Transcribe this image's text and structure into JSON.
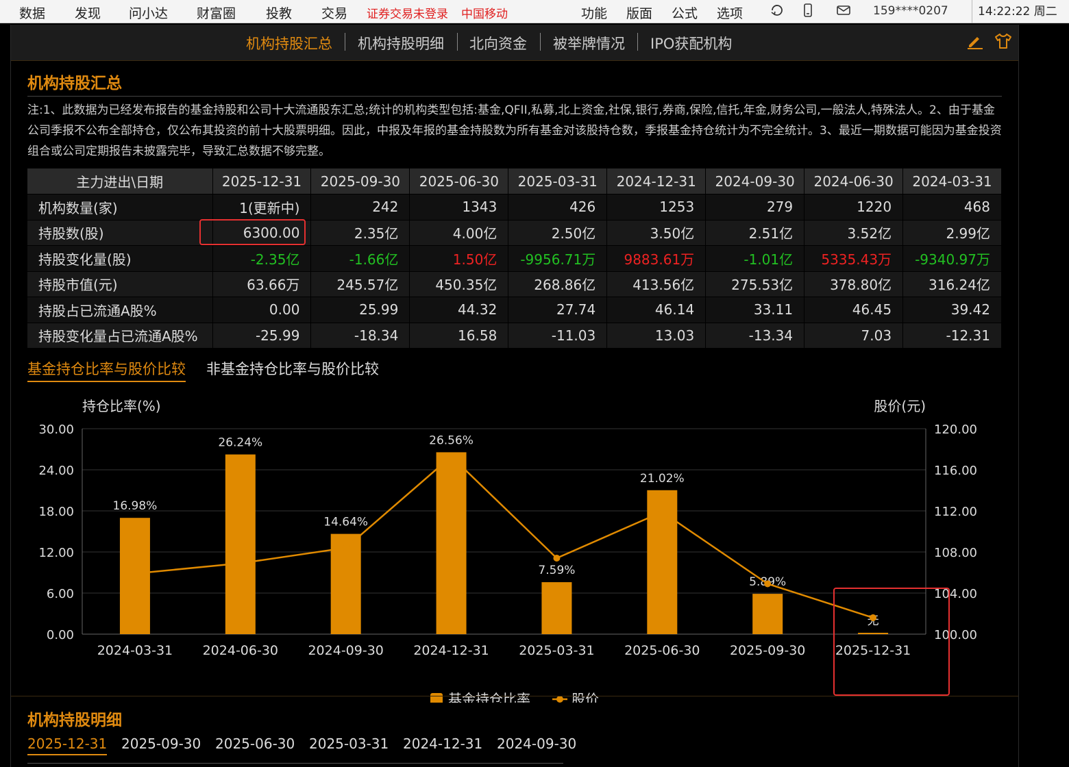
{
  "topbar": {
    "menu": [
      "数据",
      "发现",
      "问小达",
      "财富圈",
      "投教",
      "交易"
    ],
    "warning": "证券交易未登录",
    "carrier": "中国移动",
    "right_menu": [
      "功能",
      "版面",
      "公式",
      "选项"
    ],
    "phone": "159****0207",
    "time": "14:22:22 周二"
  },
  "subnav": {
    "tabs": [
      "机构持股汇总",
      "机构持股明细",
      "北向资金",
      "被举牌情况",
      "IPO获配机构"
    ],
    "active_index": 0
  },
  "summary": {
    "title": "机构持股汇总",
    "note": "注:1、此数据为已经发布报告的基金持股和公司十大流通股东汇总;统计的机构类型包括:基金,QFII,私募,北上资金,社保,银行,券商,保险,信托,年金,财务公司,一般法人,特殊法人。2、由于基金公司季报不公布全部持仓，仅公布其投资的前十大股票明细。因此，中报及年报的基金持股数为所有基金对该股持仓数，季报基金持仓统计为不完全统计。3、最近一期数据可能因为基金投资组合或公司定期报告未披露完毕，导致汇总数据不够完整。"
  },
  "table": {
    "header_label": "主力进出\\日期",
    "dates": [
      "2025-12-31",
      "2025-09-30",
      "2025-06-30",
      "2025-03-31",
      "2024-12-31",
      "2024-09-30",
      "2024-06-30",
      "2024-03-31"
    ],
    "rows": [
      {
        "label": "机构数量(家)",
        "values": [
          "1(更新中)",
          "242",
          "1343",
          "426",
          "1253",
          "279",
          "1220",
          "468"
        ]
      },
      {
        "label": "持股数(股)",
        "values": [
          "6300.00",
          "2.35亿",
          "4.00亿",
          "2.50亿",
          "3.50亿",
          "2.51亿",
          "3.52亿",
          "2.99亿"
        ]
      },
      {
        "label": "持股变化量(股)",
        "values": [
          "-2.35亿",
          "-1.66亿",
          "1.50亿",
          "-9956.71万",
          "9883.61万",
          "-1.01亿",
          "5335.43万",
          "-9340.97万"
        ]
      },
      {
        "label": "持股市值(元)",
        "values": [
          "63.66万",
          "245.57亿",
          "450.35亿",
          "268.86亿",
          "413.56亿",
          "275.53亿",
          "378.80亿",
          "316.24亿"
        ]
      },
      {
        "label": "持股占已流通A股%",
        "values": [
          "0.00",
          "25.99",
          "44.32",
          "27.74",
          "46.14",
          "33.11",
          "46.45",
          "39.42"
        ]
      },
      {
        "label": "持股变化量占已流通A股%",
        "values": [
          "-25.99",
          "-18.34",
          "16.58",
          "-11.03",
          "13.03",
          "-13.34",
          "7.03",
          "-12.31"
        ]
      }
    ]
  },
  "chart_tabs": [
    "基金持仓比率与股价比较",
    "非基金持仓比率与股价比较"
  ],
  "chart_data": {
    "type": "bar",
    "categories": [
      "2024-03-31",
      "2024-06-30",
      "2024-09-30",
      "2024-12-31",
      "2025-03-31",
      "2025-06-30",
      "2025-09-30",
      "2025-12-31"
    ],
    "series": [
      {
        "name": "基金持仓比率",
        "type": "bar",
        "axis": "left",
        "values": [
          16.98,
          26.24,
          14.64,
          26.56,
          7.59,
          21.02,
          5.89,
          0.0
        ]
      },
      {
        "name": "股价",
        "type": "line",
        "axis": "right",
        "values": [
          105.9,
          106.9,
          108.4,
          117.3,
          107.4,
          111.9,
          104.9,
          101.6
        ]
      }
    ],
    "bar_labels": [
      "16.98%",
      "26.24%",
      "14.64%",
      "26.56%",
      "7.59%",
      "21.02%",
      "5.89%",
      "无"
    ],
    "ylabel": "持仓比率(%)",
    "y2label": "股价(元)",
    "ylim": [
      0,
      30
    ],
    "y2lim": [
      100,
      120
    ],
    "yticks": [
      "0.00",
      "6.00",
      "12.00",
      "18.00",
      "24.00",
      "30.00"
    ],
    "y2ticks": [
      "100.00",
      "104.00",
      "108.00",
      "112.00",
      "116.00",
      "120.00"
    ],
    "legend_position": "bottom",
    "grid": true,
    "colors": {
      "bar": "#e08a00",
      "line": "#e08a00"
    }
  },
  "detail": {
    "title": "机构持股明细",
    "tabs": [
      "2025-12-31",
      "2025-09-30",
      "2025-06-30",
      "2025-03-31",
      "2024-12-31",
      "2024-09-30"
    ]
  }
}
